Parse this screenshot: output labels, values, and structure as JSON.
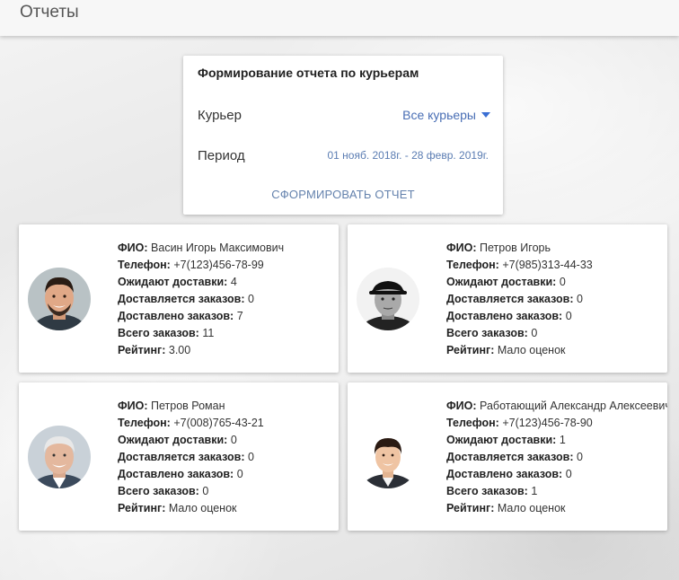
{
  "header": {
    "title": "Отчеты"
  },
  "report_form": {
    "title": "Формирование отчета по курьерам",
    "courier_label": "Курьер",
    "courier_value": "Все курьеры",
    "period_label": "Период",
    "period_value": "01 нояб. 2018г. - 28 февр. 2019г.",
    "submit_label": "СФОРМИРОВАТЬ ОТЧЕТ"
  },
  "field_labels": {
    "name": "ФИО:",
    "phone": "Телефон:",
    "awaiting": "Ожидают доставки:",
    "in_delivery": "Доставляется заказов:",
    "delivered": "Доставлено заказов:",
    "total": "Всего заказов:",
    "rating": "Рейтинг:"
  },
  "couriers": [
    {
      "name": "Васин Игорь Максимович",
      "phone": "+7(123)456-78-99",
      "awaiting": "4",
      "in_delivery": "0",
      "delivered": "7",
      "total": "11",
      "rating": "3.00"
    },
    {
      "name": "Петров Игорь",
      "phone": "+7(985)313-44-33",
      "awaiting": "0",
      "in_delivery": "0",
      "delivered": "0",
      "total": "0",
      "rating": "Мало оценок"
    },
    {
      "name": "Петров Роман",
      "phone": "+7(008)765-43-21",
      "awaiting": "0",
      "in_delivery": "0",
      "delivered": "0",
      "total": "0",
      "rating": "Мало оценок"
    },
    {
      "name": "Работающий Александр Алексеевич",
      "phone": "+7(123)456-78-90",
      "awaiting": "1",
      "in_delivery": "0",
      "delivered": "0",
      "total": "1",
      "rating": "Мало оценок"
    }
  ],
  "colors": {
    "accent": "#4a6fb5",
    "caret": "#3b6fd4"
  }
}
